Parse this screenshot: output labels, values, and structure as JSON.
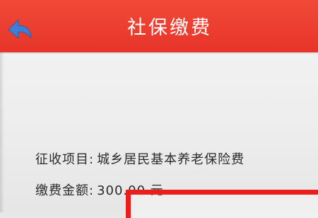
{
  "header": {
    "title": "社保缴费",
    "back_icon": "back-arrow-icon",
    "color": "#ec3b2e"
  },
  "details": {
    "item_label": "征收项目:",
    "item_value": "城乡居民基本养老保险费",
    "amount_label": "缴费金额:",
    "amount_value": "300.00 元"
  },
  "highlight_color": "#ec1d1d"
}
